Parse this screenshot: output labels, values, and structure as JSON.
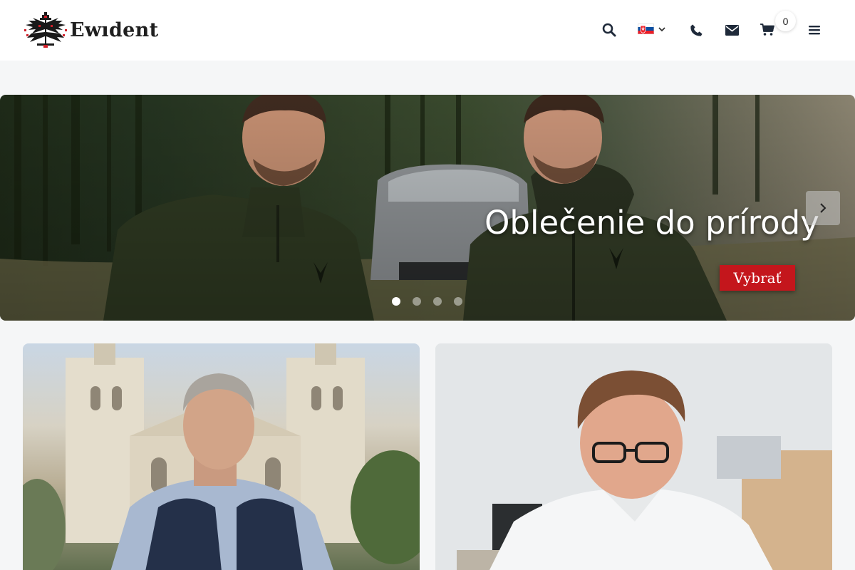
{
  "header": {
    "logo_text": "Ewıdent",
    "cart_count": "0",
    "language_flag": "slovakia-flag",
    "icons": [
      "search-icon",
      "phone-icon",
      "envelope-icon",
      "cart-icon",
      "menu-icon"
    ]
  },
  "hero": {
    "title": "Oblečenie do prírody",
    "button_label": "Vybrať",
    "slide_count": 4,
    "active_slide": 1
  },
  "colors": {
    "accent_red": "#c4161c",
    "header_bg": "#ffffff",
    "page_bg": "#f5f6f7",
    "text_dark": "#1f1f1f"
  }
}
